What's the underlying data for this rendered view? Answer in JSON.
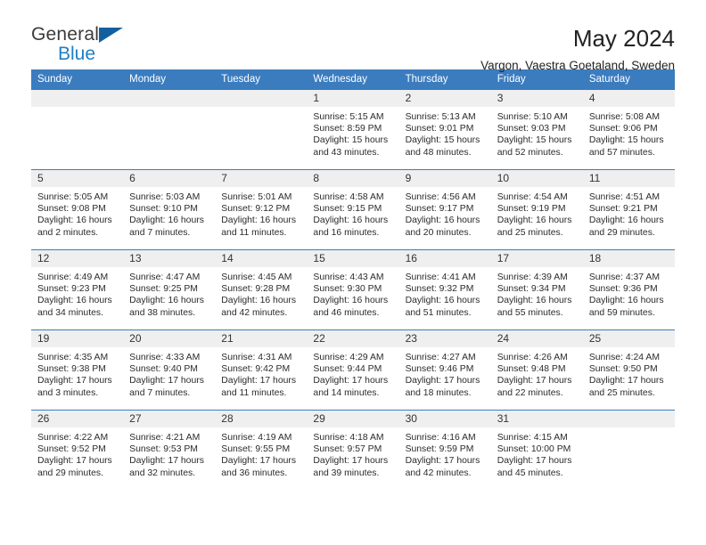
{
  "logo": {
    "word_top": "General",
    "word_bottom": "Blue",
    "triangle_color": "#14609e",
    "blue_color": "#1e7fc4"
  },
  "header": {
    "title": "May 2024",
    "subtitle": "Vargon, Vaestra Goetaland, Sweden"
  },
  "theme": {
    "header_bg": "#3b7cbf",
    "daynum_bg": "#efefef",
    "grid_line": "#3b7cbf"
  },
  "weekdays": [
    "Sunday",
    "Monday",
    "Tuesday",
    "Wednesday",
    "Thursday",
    "Friday",
    "Saturday"
  ],
  "weeks": [
    [
      {
        "day": "",
        "sunrise": "",
        "sunset": "",
        "daylight": ""
      },
      {
        "day": "",
        "sunrise": "",
        "sunset": "",
        "daylight": ""
      },
      {
        "day": "",
        "sunrise": "",
        "sunset": "",
        "daylight": ""
      },
      {
        "day": "1",
        "sunrise": "Sunrise: 5:15 AM",
        "sunset": "Sunset: 8:59 PM",
        "daylight": "Daylight: 15 hours and 43 minutes."
      },
      {
        "day": "2",
        "sunrise": "Sunrise: 5:13 AM",
        "sunset": "Sunset: 9:01 PM",
        "daylight": "Daylight: 15 hours and 48 minutes."
      },
      {
        "day": "3",
        "sunrise": "Sunrise: 5:10 AM",
        "sunset": "Sunset: 9:03 PM",
        "daylight": "Daylight: 15 hours and 52 minutes."
      },
      {
        "day": "4",
        "sunrise": "Sunrise: 5:08 AM",
        "sunset": "Sunset: 9:06 PM",
        "daylight": "Daylight: 15 hours and 57 minutes."
      }
    ],
    [
      {
        "day": "5",
        "sunrise": "Sunrise: 5:05 AM",
        "sunset": "Sunset: 9:08 PM",
        "daylight": "Daylight: 16 hours and 2 minutes."
      },
      {
        "day": "6",
        "sunrise": "Sunrise: 5:03 AM",
        "sunset": "Sunset: 9:10 PM",
        "daylight": "Daylight: 16 hours and 7 minutes."
      },
      {
        "day": "7",
        "sunrise": "Sunrise: 5:01 AM",
        "sunset": "Sunset: 9:12 PM",
        "daylight": "Daylight: 16 hours and 11 minutes."
      },
      {
        "day": "8",
        "sunrise": "Sunrise: 4:58 AM",
        "sunset": "Sunset: 9:15 PM",
        "daylight": "Daylight: 16 hours and 16 minutes."
      },
      {
        "day": "9",
        "sunrise": "Sunrise: 4:56 AM",
        "sunset": "Sunset: 9:17 PM",
        "daylight": "Daylight: 16 hours and 20 minutes."
      },
      {
        "day": "10",
        "sunrise": "Sunrise: 4:54 AM",
        "sunset": "Sunset: 9:19 PM",
        "daylight": "Daylight: 16 hours and 25 minutes."
      },
      {
        "day": "11",
        "sunrise": "Sunrise: 4:51 AM",
        "sunset": "Sunset: 9:21 PM",
        "daylight": "Daylight: 16 hours and 29 minutes."
      }
    ],
    [
      {
        "day": "12",
        "sunrise": "Sunrise: 4:49 AM",
        "sunset": "Sunset: 9:23 PM",
        "daylight": "Daylight: 16 hours and 34 minutes."
      },
      {
        "day": "13",
        "sunrise": "Sunrise: 4:47 AM",
        "sunset": "Sunset: 9:25 PM",
        "daylight": "Daylight: 16 hours and 38 minutes."
      },
      {
        "day": "14",
        "sunrise": "Sunrise: 4:45 AM",
        "sunset": "Sunset: 9:28 PM",
        "daylight": "Daylight: 16 hours and 42 minutes."
      },
      {
        "day": "15",
        "sunrise": "Sunrise: 4:43 AM",
        "sunset": "Sunset: 9:30 PM",
        "daylight": "Daylight: 16 hours and 46 minutes."
      },
      {
        "day": "16",
        "sunrise": "Sunrise: 4:41 AM",
        "sunset": "Sunset: 9:32 PM",
        "daylight": "Daylight: 16 hours and 51 minutes."
      },
      {
        "day": "17",
        "sunrise": "Sunrise: 4:39 AM",
        "sunset": "Sunset: 9:34 PM",
        "daylight": "Daylight: 16 hours and 55 minutes."
      },
      {
        "day": "18",
        "sunrise": "Sunrise: 4:37 AM",
        "sunset": "Sunset: 9:36 PM",
        "daylight": "Daylight: 16 hours and 59 minutes."
      }
    ],
    [
      {
        "day": "19",
        "sunrise": "Sunrise: 4:35 AM",
        "sunset": "Sunset: 9:38 PM",
        "daylight": "Daylight: 17 hours and 3 minutes."
      },
      {
        "day": "20",
        "sunrise": "Sunrise: 4:33 AM",
        "sunset": "Sunset: 9:40 PM",
        "daylight": "Daylight: 17 hours and 7 minutes."
      },
      {
        "day": "21",
        "sunrise": "Sunrise: 4:31 AM",
        "sunset": "Sunset: 9:42 PM",
        "daylight": "Daylight: 17 hours and 11 minutes."
      },
      {
        "day": "22",
        "sunrise": "Sunrise: 4:29 AM",
        "sunset": "Sunset: 9:44 PM",
        "daylight": "Daylight: 17 hours and 14 minutes."
      },
      {
        "day": "23",
        "sunrise": "Sunrise: 4:27 AM",
        "sunset": "Sunset: 9:46 PM",
        "daylight": "Daylight: 17 hours and 18 minutes."
      },
      {
        "day": "24",
        "sunrise": "Sunrise: 4:26 AM",
        "sunset": "Sunset: 9:48 PM",
        "daylight": "Daylight: 17 hours and 22 minutes."
      },
      {
        "day": "25",
        "sunrise": "Sunrise: 4:24 AM",
        "sunset": "Sunset: 9:50 PM",
        "daylight": "Daylight: 17 hours and 25 minutes."
      }
    ],
    [
      {
        "day": "26",
        "sunrise": "Sunrise: 4:22 AM",
        "sunset": "Sunset: 9:52 PM",
        "daylight": "Daylight: 17 hours and 29 minutes."
      },
      {
        "day": "27",
        "sunrise": "Sunrise: 4:21 AM",
        "sunset": "Sunset: 9:53 PM",
        "daylight": "Daylight: 17 hours and 32 minutes."
      },
      {
        "day": "28",
        "sunrise": "Sunrise: 4:19 AM",
        "sunset": "Sunset: 9:55 PM",
        "daylight": "Daylight: 17 hours and 36 minutes."
      },
      {
        "day": "29",
        "sunrise": "Sunrise: 4:18 AM",
        "sunset": "Sunset: 9:57 PM",
        "daylight": "Daylight: 17 hours and 39 minutes."
      },
      {
        "day": "30",
        "sunrise": "Sunrise: 4:16 AM",
        "sunset": "Sunset: 9:59 PM",
        "daylight": "Daylight: 17 hours and 42 minutes."
      },
      {
        "day": "31",
        "sunrise": "Sunrise: 4:15 AM",
        "sunset": "Sunset: 10:00 PM",
        "daylight": "Daylight: 17 hours and 45 minutes."
      },
      {
        "day": "",
        "sunrise": "",
        "sunset": "",
        "daylight": ""
      }
    ]
  ]
}
